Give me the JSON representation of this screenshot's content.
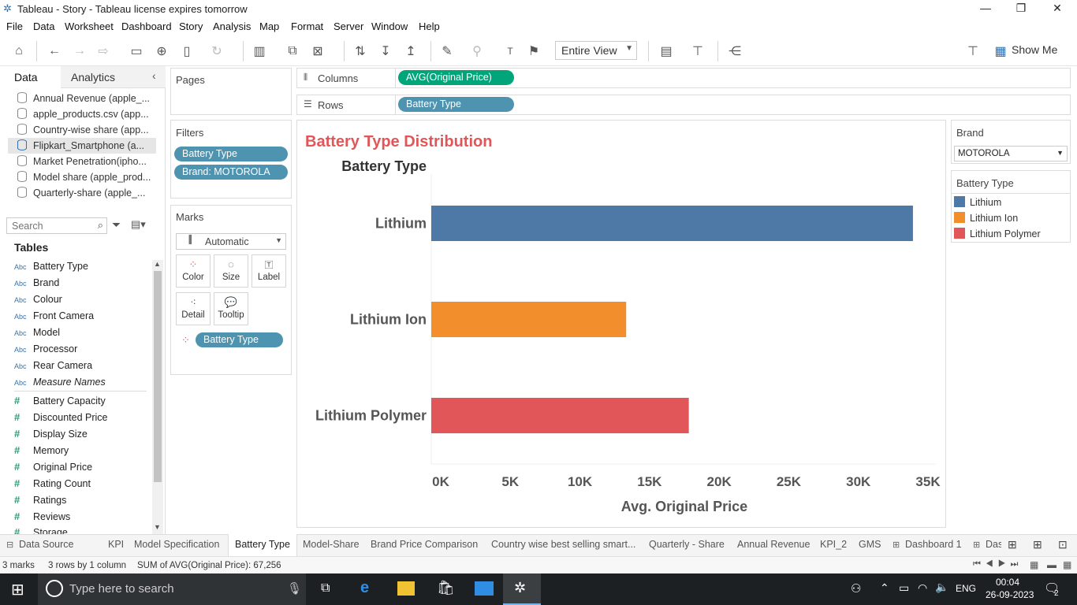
{
  "window": {
    "title": "Tableau - Story - Tableau license expires tomorrow"
  },
  "menu": [
    "File",
    "Data",
    "Worksheet",
    "Dashboard",
    "Story",
    "Analysis",
    "Map",
    "Format",
    "Server",
    "Window",
    "Help"
  ],
  "toolbar": {
    "fit": "Entire View",
    "show_me": "Show Me"
  },
  "data_pane": {
    "tab_data": "Data",
    "tab_analytics": "Analytics",
    "sources": [
      "Annual Revenue (apple_...",
      "apple_products.csv (app...",
      "Country-wise share (app...",
      "Flipkart_Smartphone (a...",
      "Market Penetration(ipho...",
      "Model share (apple_prod...",
      "Quarterly-share (apple_..."
    ],
    "search_placeholder": "Search",
    "tables_label": "Tables",
    "dimensions": [
      "Battery Type",
      "Brand",
      "Colour",
      "Front Camera",
      "Model",
      "Processor",
      "Rear Camera",
      "Measure Names"
    ],
    "dimension_icon": "Abc",
    "measures": [
      "Battery Capacity",
      "Discounted Price",
      "Display Size",
      "Memory",
      "Original Price",
      "Rating Count",
      "Ratings",
      "Reviews",
      "Storage"
    ],
    "measure_icon": "#"
  },
  "pages": {
    "label": "Pages"
  },
  "filters": {
    "label": "Filters",
    "items": [
      "Battery Type",
      "Brand: MOTOROLA"
    ]
  },
  "marks": {
    "label": "Marks",
    "type": "Automatic",
    "buttons": [
      "Color",
      "Size",
      "Label",
      "Detail",
      "Tooltip"
    ],
    "color_pill": "Battery Type"
  },
  "shelves": {
    "columns_label": "Columns",
    "columns_pill": "AVG(Original Price)",
    "rows_label": "Rows",
    "rows_pill": "Battery Type"
  },
  "brand_filter": {
    "label": "Brand",
    "value": "MOTOROLA"
  },
  "legend": {
    "label": "Battery Type",
    "items": [
      "Lithium",
      "Lithium Ion",
      "Lithium Polymer"
    ]
  },
  "colors": {
    "Lithium": "#4e79a7",
    "Lithium Ion": "#f28e2b",
    "Lithium Polymer": "#e15759",
    "title": "#e15759"
  },
  "chart_data": {
    "type": "bar",
    "orientation": "horizontal",
    "title": "Battery Type Distribution",
    "row_header": "Battery Type",
    "categories": [
      "Lithium",
      "Lithium Ion",
      "Lithium Polymer"
    ],
    "values": [
      34600,
      14000,
      18500
    ],
    "xlabel": "Avg. Original Price",
    "xlim": [
      0,
      36000
    ],
    "x_ticks": [
      0,
      5000,
      10000,
      15000,
      20000,
      25000,
      30000,
      35000
    ],
    "x_tick_labels": [
      "0K",
      "5K",
      "10K",
      "15K",
      "20K",
      "25K",
      "30K",
      "35K"
    ]
  },
  "tabs": [
    "Data Source",
    "KPI",
    "Model Specification",
    "Battery Type",
    "Model-Share",
    "Brand Price Comparison",
    "Country wise best selling smart...",
    "Quarterly - Share",
    "Annual Revenue",
    "KPI_2",
    "GMS",
    "Dashboard 1",
    "Das"
  ],
  "active_tab": "Battery Type",
  "status": {
    "marks": "3 marks",
    "rows": "3 rows by 1 column",
    "sum": "SUM of AVG(Original Price): 67,256"
  },
  "taskbar": {
    "search_placeholder": "Type here to search",
    "lang": "ENG",
    "time": "00:04",
    "date": "26-09-2023",
    "notifications": "2"
  }
}
